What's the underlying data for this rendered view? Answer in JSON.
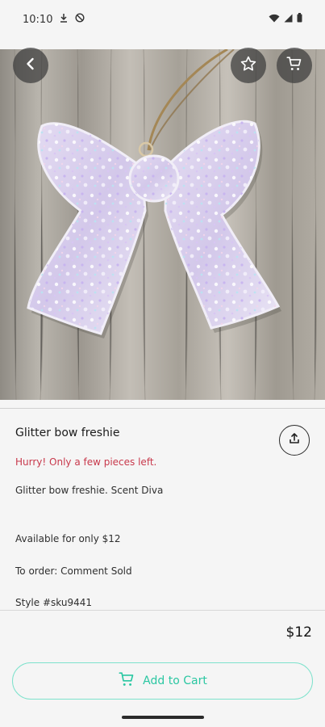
{
  "status_bar": {
    "time": "10:10"
  },
  "hero": {
    "pager": {
      "count": 1,
      "active": 0
    }
  },
  "product": {
    "title": "Glitter bow freshie",
    "urgency": "Hurry! Only a few pieces left.",
    "description_lines": [
      "Glitter bow freshie. Scent Diva",
      "",
      "Available for only $12",
      "",
      "To order: Comment Sold",
      "",
      "Style #sku9441"
    ],
    "price": "$12"
  },
  "actions": {
    "add_to_cart_label": "Add to Cart"
  },
  "colors": {
    "accent": "#34d1b0",
    "urgency": "#c8394c",
    "button_text": "#2bc7a2"
  },
  "icons": {
    "back": "arrow-left-icon",
    "favorite": "star-icon",
    "cart": "shopping-cart-icon",
    "share": "share-upload-icon"
  }
}
